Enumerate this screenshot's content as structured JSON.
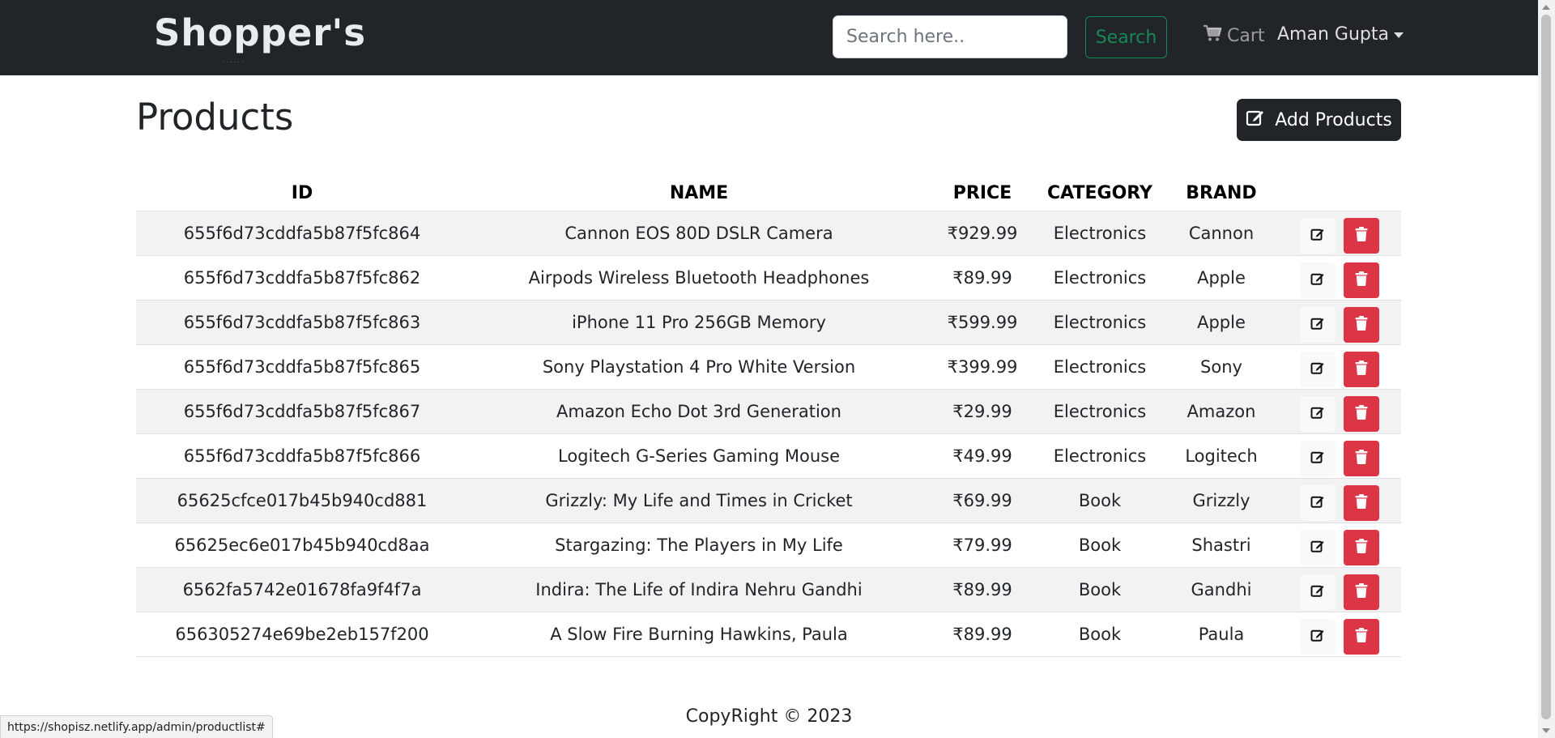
{
  "navbar": {
    "brand": "Shopper's",
    "brand_dots": "......",
    "search_placeholder": "Search here..",
    "search_button": "Search",
    "cart_label": "Cart",
    "user_name": "Aman Gupta"
  },
  "main": {
    "title": "Products",
    "add_button": "Add Products"
  },
  "table": {
    "headers": [
      "ID",
      "NAME",
      "PRICE",
      "CATEGORY",
      "BRAND"
    ],
    "rows": [
      {
        "id": "655f6d73cddfa5b87f5fc864",
        "name": "Cannon EOS 80D DSLR Camera",
        "price": "₹929.99",
        "category": "Electronics",
        "brand": "Cannon"
      },
      {
        "id": "655f6d73cddfa5b87f5fc862",
        "name": "Airpods Wireless Bluetooth Headphones",
        "price": "₹89.99",
        "category": "Electronics",
        "brand": "Apple"
      },
      {
        "id": "655f6d73cddfa5b87f5fc863",
        "name": "iPhone 11 Pro 256GB Memory",
        "price": "₹599.99",
        "category": "Electronics",
        "brand": "Apple"
      },
      {
        "id": "655f6d73cddfa5b87f5fc865",
        "name": "Sony Playstation 4 Pro White Version",
        "price": "₹399.99",
        "category": "Electronics",
        "brand": "Sony"
      },
      {
        "id": "655f6d73cddfa5b87f5fc867",
        "name": "Amazon Echo Dot 3rd Generation",
        "price": "₹29.99",
        "category": "Electronics",
        "brand": "Amazon"
      },
      {
        "id": "655f6d73cddfa5b87f5fc866",
        "name": "Logitech G-Series Gaming Mouse",
        "price": "₹49.99",
        "category": "Electronics",
        "brand": "Logitech"
      },
      {
        "id": "65625cfce017b45b940cd881",
        "name": "Grizzly: My Life and Times in Cricket",
        "price": "₹69.99",
        "category": "Book",
        "brand": "Grizzly"
      },
      {
        "id": "65625ec6e017b45b940cd8aa",
        "name": "Stargazing: The Players in My Life",
        "price": "₹79.99",
        "category": "Book",
        "brand": "Shastri"
      },
      {
        "id": "6562fa5742e01678fa9f4f7a",
        "name": "Indira: The Life of Indira Nehru Gandhi",
        "price": "₹89.99",
        "category": "Book",
        "brand": "Gandhi"
      },
      {
        "id": "656305274e69be2eb157f200",
        "name": "A Slow Fire Burning Hawkins, Paula",
        "price": "₹89.99",
        "category": "Book",
        "brand": "Paula"
      }
    ]
  },
  "footer": {
    "copyright": "CopyRight © 2023"
  },
  "status_bar": {
    "url": "https://shopisz.netlify.app/admin/productlist#"
  },
  "colors": {
    "navbar_bg": "#212529",
    "search_green": "#198754",
    "delete_red": "#dc3545",
    "row_stripe": "#f2f2f2"
  },
  "icons": {
    "cart": "cart-icon",
    "add": "edit-square-icon",
    "edit": "edit-icon",
    "delete": "trash-icon",
    "user_menu": "caret-down-icon"
  }
}
